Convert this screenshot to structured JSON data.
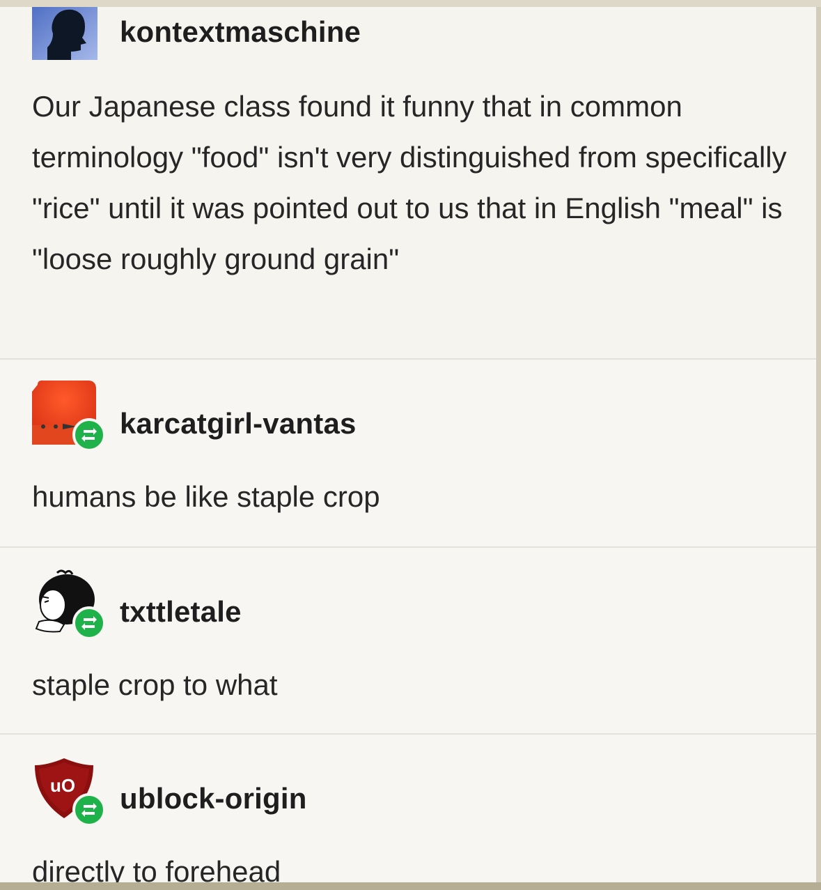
{
  "posts": [
    {
      "username": "kontextmaschine",
      "avatar_icon": "silhouette-avatar-icon",
      "text": "Our Japanese class found it funny that in common terminology \"food\" isn't very distinguished from specifically \"rice\" until it was pointed out to us that in English \"meal\" is \"loose roughly ground grain\""
    },
    {
      "username": "karcatgirl-vantas",
      "avatar_icon": "red-face-avatar-icon",
      "reblog_icon": "reblog-icon",
      "text": "humans be like staple crop"
    },
    {
      "username": "txttletale",
      "avatar_icon": "cartoon-girl-avatar-icon",
      "reblog_icon": "reblog-icon",
      "text": "staple crop to what"
    },
    {
      "username": "ublock-origin",
      "avatar_icon": "ublock-shield-avatar-icon",
      "avatar_text": "uO",
      "reblog_icon": "reblog-icon",
      "text": "directly to forehead"
    }
  ],
  "colors": {
    "reblog_green": "#1fb14a",
    "ublock_red": "#8b0f0f",
    "karcat_red": "#e53a1f"
  }
}
